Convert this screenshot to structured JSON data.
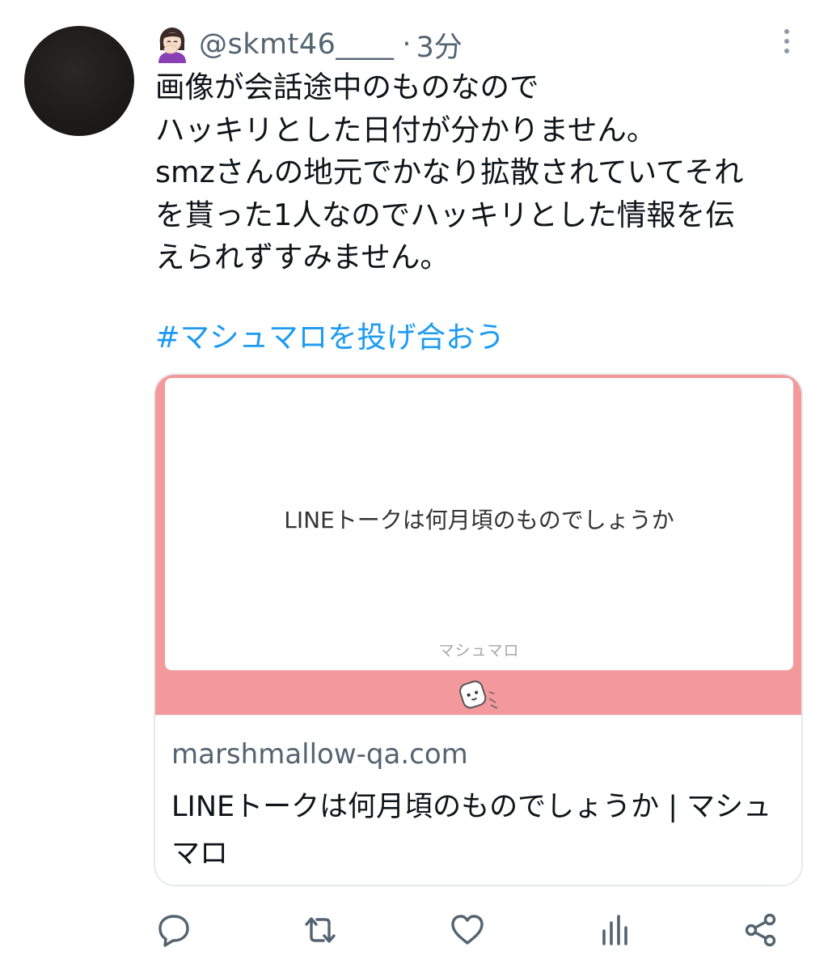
{
  "tweet": {
    "handle": "@skmt46____",
    "separator": "·",
    "time": "3分",
    "text_lines": [
      "画像が会話途中のものなので",
      "ハッキリとした日付が分かりません。",
      "smzさんの地元でかなり拡散されていてそれ",
      "を貰った1人なのでハッキリとした情報を伝",
      "えられずすみません。"
    ],
    "hashtag": "#マシュマロを投げ合おう"
  },
  "card": {
    "question": "LINEトークは何月頃のものでしょうか",
    "brand": "マシュマロ",
    "domain": "marshmallow-qa.com",
    "title": "LINEトークは何月頃のものでしょうか | マシュマロ",
    "accent_color": "#f3999b"
  },
  "icons": {
    "author_emoji": "woman-facepalming-emoji",
    "more": "more-vertical-icon",
    "reply": "reply-icon",
    "retweet": "retweet-icon",
    "like": "heart-icon",
    "analytics": "analytics-icon",
    "share": "share-icon"
  },
  "colors": {
    "link": "#1d9bf0",
    "secondary_text": "#536471",
    "border": "#e6e9eb"
  }
}
